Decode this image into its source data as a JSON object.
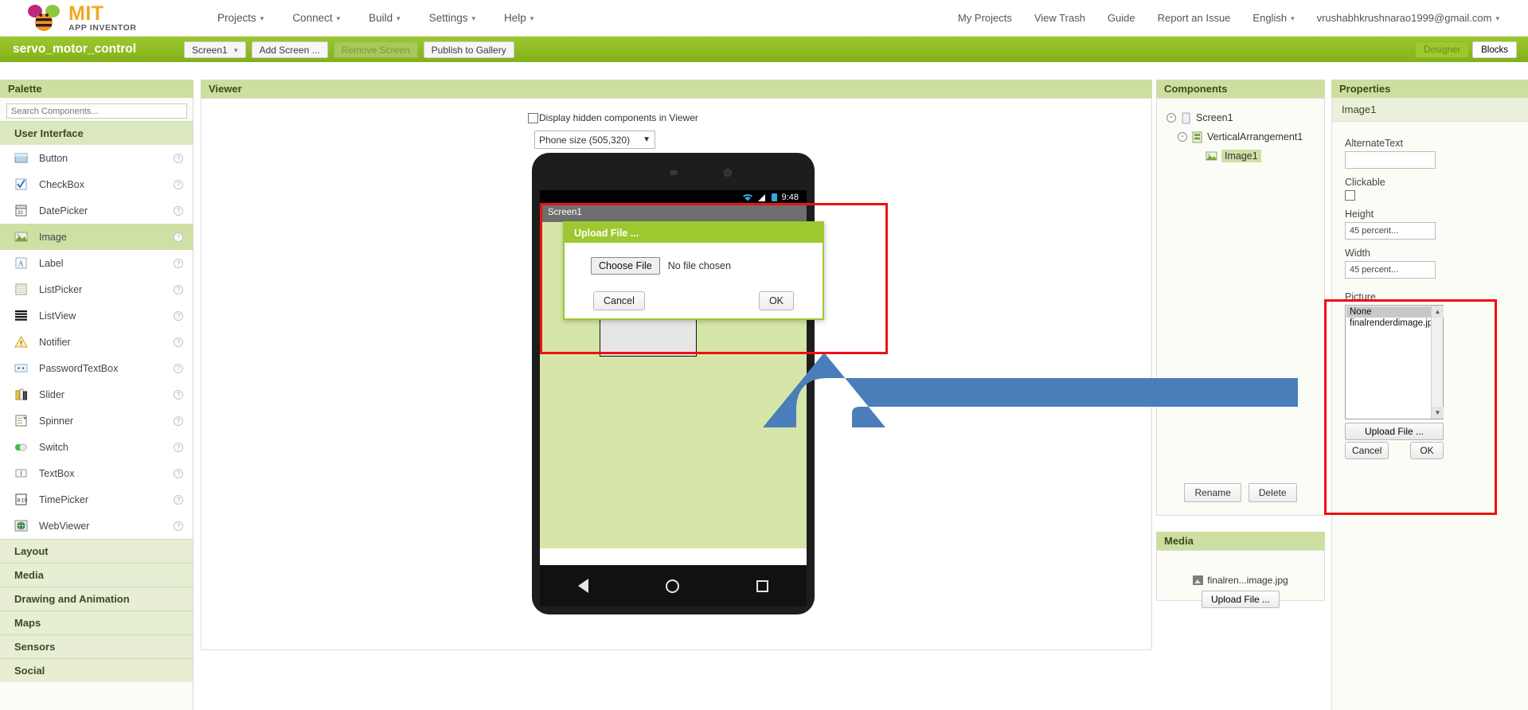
{
  "brand": {
    "mit": "MIT",
    "subtitle": "APP INVENTOR"
  },
  "topnav": {
    "left_items": [
      {
        "label": "Projects",
        "caret": true
      },
      {
        "label": "Connect",
        "caret": true
      },
      {
        "label": "Build",
        "caret": true
      },
      {
        "label": "Settings",
        "caret": true
      },
      {
        "label": "Help",
        "caret": true
      }
    ],
    "right_items": [
      {
        "label": "My Projects",
        "caret": false
      },
      {
        "label": "View Trash",
        "caret": false
      },
      {
        "label": "Guide",
        "caret": false
      },
      {
        "label": "Report an Issue",
        "caret": false
      },
      {
        "label": "English",
        "caret": true
      },
      {
        "label": "vrushabhkrushnarao1999@gmail.com",
        "caret": true
      }
    ]
  },
  "project": {
    "name": "servo_motor_control",
    "screen_selector": "Screen1",
    "add_screen": "Add Screen ...",
    "remove_screen": "Remove Screen",
    "publish": "Publish to Gallery",
    "designer_tab": "Designer",
    "blocks_tab": "Blocks"
  },
  "palette": {
    "title": "Palette",
    "search_placeholder": "Search Components...",
    "search_value": "",
    "categories": [
      {
        "label": "User Interface",
        "open": true
      },
      {
        "label": "Layout",
        "open": false
      },
      {
        "label": "Media",
        "open": false
      },
      {
        "label": "Drawing and Animation",
        "open": false
      },
      {
        "label": "Maps",
        "open": false
      },
      {
        "label": "Sensors",
        "open": false
      },
      {
        "label": "Social",
        "open": false
      }
    ],
    "user_interface_items": [
      {
        "label": "Button",
        "icon": "button-icon",
        "selected": false
      },
      {
        "label": "CheckBox",
        "icon": "checkbox-icon",
        "selected": false
      },
      {
        "label": "DatePicker",
        "icon": "datepicker-icon",
        "selected": false
      },
      {
        "label": "Image",
        "icon": "image-icon",
        "selected": true
      },
      {
        "label": "Label",
        "icon": "label-icon",
        "selected": false
      },
      {
        "label": "ListPicker",
        "icon": "listpicker-icon",
        "selected": false
      },
      {
        "label": "ListView",
        "icon": "listview-icon",
        "selected": false
      },
      {
        "label": "Notifier",
        "icon": "notifier-icon",
        "selected": false
      },
      {
        "label": "PasswordTextBox",
        "icon": "passwordtextbox-icon",
        "selected": false
      },
      {
        "label": "Slider",
        "icon": "slider-icon",
        "selected": false
      },
      {
        "label": "Spinner",
        "icon": "spinner-icon",
        "selected": false
      },
      {
        "label": "Switch",
        "icon": "switch-icon",
        "selected": false
      },
      {
        "label": "TextBox",
        "icon": "textbox-icon",
        "selected": false
      },
      {
        "label": "TimePicker",
        "icon": "timepicker-icon",
        "selected": false
      },
      {
        "label": "WebViewer",
        "icon": "webviewer-icon",
        "selected": false
      }
    ],
    "help_glyph": "?"
  },
  "viewer": {
    "title": "Viewer",
    "hidden_components_label": "Display hidden components in Viewer",
    "hidden_components_checked": false,
    "size_selector": "Phone size (505,320)",
    "phone": {
      "status_time": "9:48",
      "screen_title": "Screen1",
      "nav_back": "back-triangle",
      "nav_home": "home-circle",
      "nav_recent": "recents-square"
    }
  },
  "upload_dialog": {
    "title": "Upload File ...",
    "choose_file_label": "Choose File",
    "no_file_text": "No file chosen",
    "cancel_label": "Cancel",
    "ok_label": "OK"
  },
  "components": {
    "title": "Components",
    "tree": [
      {
        "label": "Screen1",
        "level": 1,
        "icon": "screen-icon",
        "expander": "-",
        "selected": false
      },
      {
        "label": "VerticalArrangement1",
        "level": 2,
        "icon": "vertical-arrangement-icon",
        "expander": "-",
        "selected": false
      },
      {
        "label": "Image1",
        "level": 3,
        "icon": "image-icon",
        "expander": "",
        "selected": true
      }
    ],
    "rename_label": "Rename",
    "delete_label": "Delete"
  },
  "media": {
    "title": "Media",
    "files": [
      "finalren...image.jpg"
    ],
    "upload_label": "Upload File ..."
  },
  "properties": {
    "title": "Properties",
    "component_name": "Image1",
    "fields": [
      {
        "label": "AlternateText",
        "type": "text",
        "value": ""
      },
      {
        "label": "Clickable",
        "type": "checkbox",
        "checked": false
      },
      {
        "label": "Height",
        "type": "text",
        "value": "45 percent..."
      },
      {
        "label": "Width",
        "type": "text",
        "value": "45 percent..."
      }
    ],
    "picture": {
      "label": "Picture",
      "options": [
        {
          "label": "None",
          "selected": true
        },
        {
          "label": "finalrenderdimage.jpg",
          "selected": false
        }
      ],
      "upload_label": "Upload File ...",
      "cancel_label": "Cancel",
      "ok_label": "OK"
    }
  },
  "annotations": {
    "highlight_color": "#ee1111",
    "arrow_color": "#4a7ebb"
  }
}
